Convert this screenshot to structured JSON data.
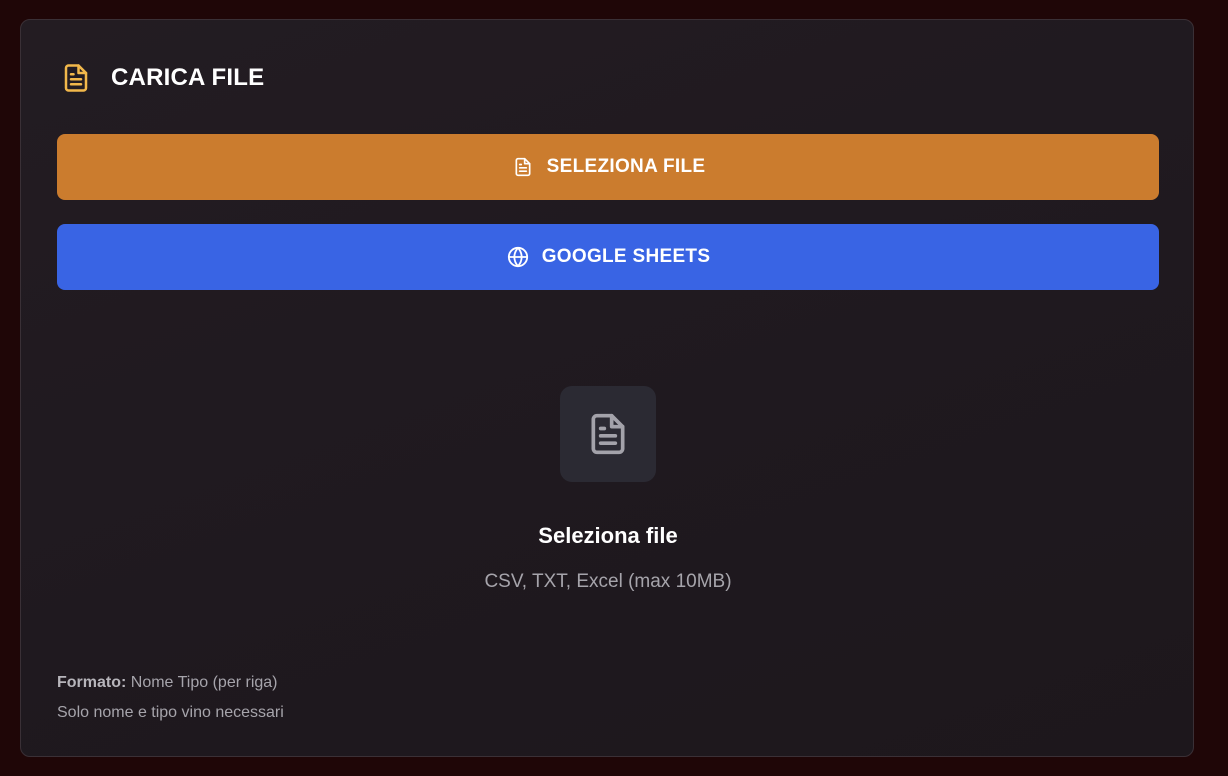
{
  "header": {
    "title": "CARICA FILE",
    "icon": "file-text-icon"
  },
  "buttons": {
    "select_file": {
      "label": "SELEZIONA FILE",
      "icon": "file-text-icon",
      "color": "#cb7c2e"
    },
    "google_sheets": {
      "label": "GOOGLE SHEETS",
      "icon": "globe-icon",
      "color": "#3964e4"
    }
  },
  "dropzone": {
    "icon": "file-text-icon",
    "title": "Seleziona file",
    "subtitle": "CSV, TXT, Excel (max 10MB)"
  },
  "footer": {
    "format_label": "Formato:",
    "format_value": " Nome Tipo (per riga)",
    "note": "Solo nome e tipo vino necessari"
  },
  "colors": {
    "accent_yellow": "#f2b84b",
    "background": "#1f0607",
    "card": "#211a20"
  }
}
